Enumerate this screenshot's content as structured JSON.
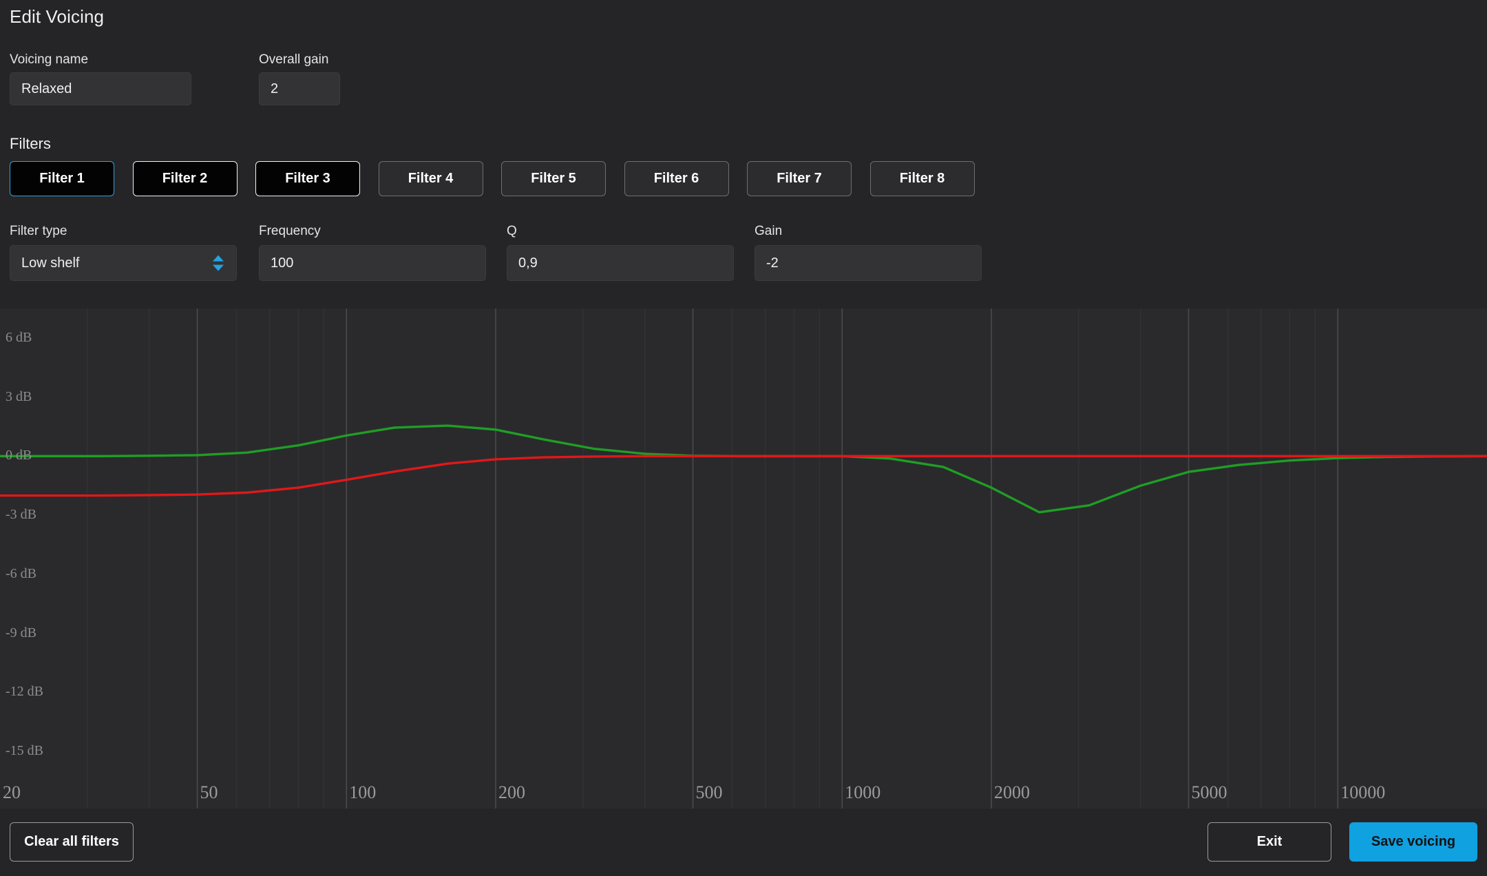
{
  "header": {
    "title": "Edit Voicing"
  },
  "voicing": {
    "name_label": "Voicing name",
    "name_value": "Relaxed",
    "gain_label": "Overall gain",
    "gain_value": "2"
  },
  "filters": {
    "section_label": "Filters",
    "tabs": [
      {
        "label": "Filter 1",
        "state": "selected"
      },
      {
        "label": "Filter 2",
        "state": "configured"
      },
      {
        "label": "Filter 3",
        "state": "configured"
      },
      {
        "label": "Filter 4",
        "state": "empty"
      },
      {
        "label": "Filter 5",
        "state": "empty"
      },
      {
        "label": "Filter 6",
        "state": "empty"
      },
      {
        "label": "Filter 7",
        "state": "empty"
      },
      {
        "label": "Filter 8",
        "state": "empty"
      }
    ]
  },
  "params": {
    "filter_type_label": "Filter type",
    "filter_type_value": "Low shelf",
    "frequency_label": "Frequency",
    "frequency_value": "100",
    "q_label": "Q",
    "q_value": "0,9",
    "gain_label": "Gain",
    "gain_value": "-2"
  },
  "footer": {
    "clear_label": "Clear all filters",
    "exit_label": "Exit",
    "save_label": "Save voicing"
  },
  "colors": {
    "accent": "#0fa1e0",
    "selected_border": "#2ea3e0",
    "curve_green": "#1f9e24",
    "curve_red": "#e01818",
    "panel_bg": "#252528",
    "graph_bg": "#2a2a2d",
    "field_bg": "#333336"
  },
  "chart_data": {
    "type": "line",
    "title": "",
    "xlabel": "",
    "ylabel": "",
    "xscale": "log",
    "xlim": [
      20,
      20000
    ],
    "ylim": [
      -16.5,
      7.5
    ],
    "grid": true,
    "legend": "none",
    "ytick_labels": [
      "6 dB",
      "3 dB",
      "0 dB",
      "-3 dB",
      "-6 dB",
      "-9 dB",
      "-12 dB",
      "-15 dB"
    ],
    "yticks": [
      6,
      3,
      0,
      -3,
      -6,
      -9,
      -12,
      -15
    ],
    "xtick_labels": [
      "20",
      "50",
      "100",
      "200",
      "500",
      "1000",
      "2000",
      "5000",
      "10000"
    ],
    "xticks": [
      20,
      50,
      100,
      200,
      500,
      1000,
      2000,
      5000,
      10000
    ],
    "x": [
      20,
      25,
      32,
      40,
      50,
      63,
      80,
      100,
      125,
      160,
      200,
      250,
      315,
      400,
      500,
      630,
      800,
      1000,
      1250,
      1600,
      2000,
      2500,
      3150,
      4000,
      5000,
      6300,
      8000,
      10000,
      12500,
      16000,
      20000
    ],
    "series": [
      {
        "name": "green-curve",
        "color": "#1f9e24",
        "values": [
          0.0,
          0.0,
          0.0,
          0.02,
          0.05,
          0.18,
          0.55,
          1.05,
          1.45,
          1.55,
          1.35,
          0.85,
          0.38,
          0.12,
          0.02,
          0.0,
          0.0,
          0.0,
          -0.12,
          -0.55,
          -1.6,
          -2.85,
          -2.5,
          -1.5,
          -0.8,
          -0.45,
          -0.22,
          -0.1,
          -0.04,
          -0.01,
          0.0
        ]
      },
      {
        "name": "red-curve",
        "color": "#e01818",
        "values": [
          -2.0,
          -2.0,
          -2.0,
          -1.98,
          -1.95,
          -1.85,
          -1.6,
          -1.2,
          -0.78,
          -0.38,
          -0.16,
          -0.06,
          -0.02,
          0.0,
          0.0,
          0.0,
          0.0,
          0.0,
          0.0,
          0.0,
          0.0,
          0.0,
          0.0,
          0.0,
          0.0,
          0.0,
          0.0,
          0.0,
          0.0,
          0.0,
          0.0
        ]
      }
    ]
  }
}
